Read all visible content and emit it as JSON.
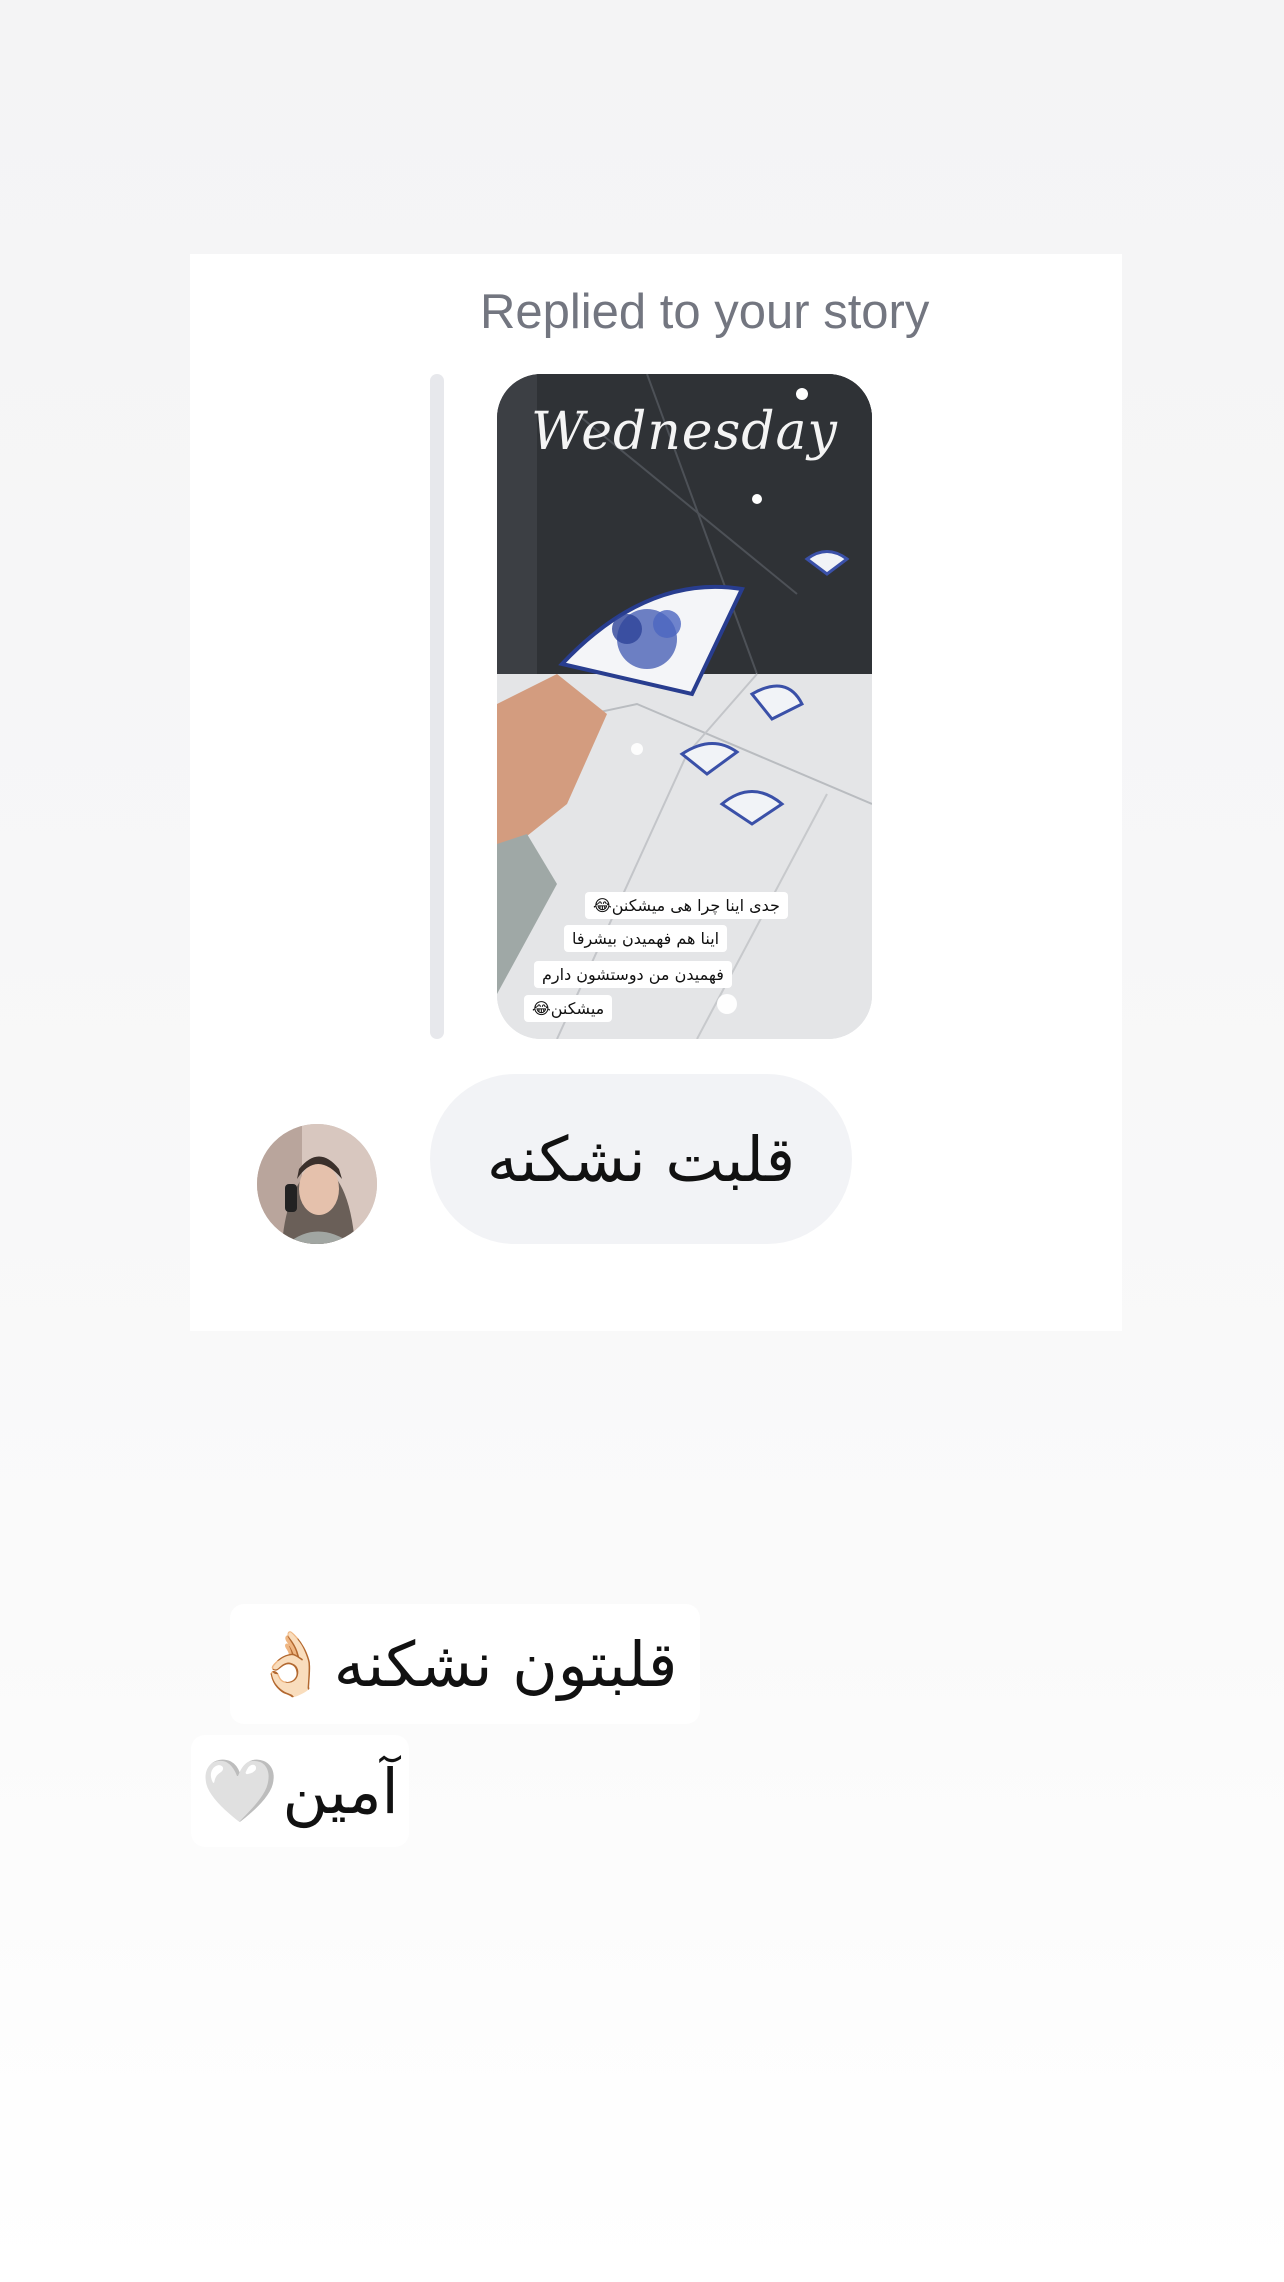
{
  "reply": {
    "label": "Replied to your story",
    "message": "قلبت نشکنه"
  },
  "story": {
    "title_word": "Wednesday",
    "captions": [
      "جدی اینا چرا هی میشکنن😂",
      "اینا هم فهمیدن بیشرفا",
      "فهمیدن من دوستشون دارم",
      "میشکنن😂"
    ]
  },
  "overlay": {
    "line1_text": "قلبتون نشکنه",
    "line1_emoji": "👌🏻",
    "line2_text": "آمین",
    "line2_emoji": "🤍"
  },
  "icons": {
    "avatar": "user-avatar-photo",
    "story": "story-thumbnail-image"
  }
}
